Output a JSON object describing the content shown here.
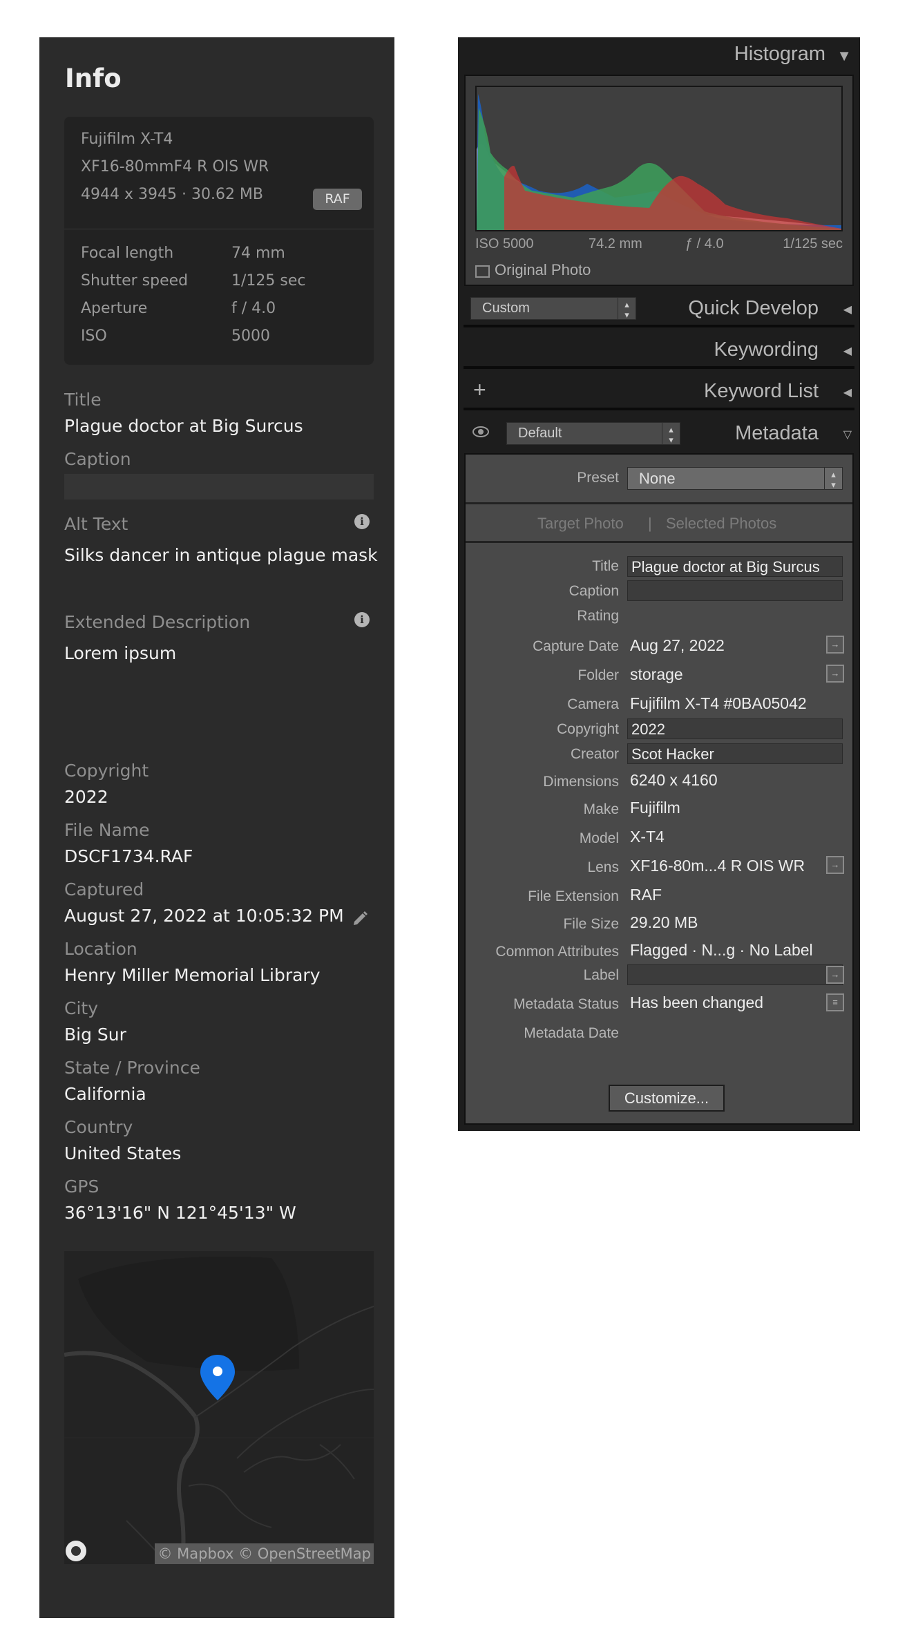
{
  "info_panel": {
    "title": "Info",
    "camera": {
      "model": "Fujifilm X-T4",
      "lens": "XF16-80mmF4 R OIS WR",
      "dimensions_size": "4944 x 3945  ·  30.62 MB",
      "format_badge": "RAF"
    },
    "exif": [
      {
        "label": "Focal length",
        "value": "74 mm"
      },
      {
        "label": "Shutter speed",
        "value": "1/125 sec"
      },
      {
        "label": "Aperture",
        "value": "f / 4.0"
      },
      {
        "label": "ISO",
        "value": "5000"
      }
    ],
    "fields": {
      "title_label": "Title",
      "title_value": "Plague doctor at Big Surcus",
      "caption_label": "Caption",
      "alt_label": "Alt Text",
      "alt_value": "Silks dancer in antique plague mask",
      "ext_label": "Extended Description",
      "ext_value": "Lorem ipsum",
      "copyright_label": "Copyright",
      "copyright_value": "2022",
      "filename_label": "File Name",
      "filename_value": "DSCF1734.RAF",
      "captured_label": "Captured",
      "captured_value": "August 27, 2022 at 10:05:32 PM",
      "location_label": "Location",
      "location_value": "Henry Miller Memorial Library",
      "city_label": "City",
      "city_value": "Big Sur",
      "state_label": "State / Province",
      "state_value": "California",
      "country_label": "Country",
      "country_value": "United States",
      "gps_label": "GPS",
      "gps_value": "36°13'16\" N 121°45'13\" W"
    },
    "map": {
      "credit": "© Mapbox © OpenStreetMap",
      "pin_color": "#1473e6"
    }
  },
  "lightroom_panel": {
    "histogram": {
      "title": "Histogram",
      "iso": "ISO 5000",
      "focal": "74.2 mm",
      "aperture": "ƒ / 4.0",
      "shutter": "1/125 sec",
      "original_photo_label": "Original Photo",
      "original_photo_checked": false
    },
    "quick_develop": {
      "title": "Quick Develop",
      "preset": "Custom"
    },
    "keywording": {
      "title": "Keywording"
    },
    "keyword_list": {
      "title": "Keyword List",
      "add_icon": "plus-icon"
    },
    "metadata": {
      "title": "Metadata",
      "view_preset": "Default",
      "preset_label": "Preset",
      "preset_value": "None",
      "target_photo": "Target Photo",
      "selected_photos": "Selected Photos",
      "rows": {
        "title_label": "Title",
        "title_value": "Plague doctor at Big Surcus",
        "caption_label": "Caption",
        "caption_value": "",
        "rating_label": "Rating",
        "capture_date_label": "Capture Date",
        "capture_date_value": "Aug 27, 2022",
        "folder_label": "Folder",
        "folder_value": "storage",
        "camera_label": "Camera",
        "camera_value": "Fujifilm X-T4 #0BA05042",
        "copyright_label": "Copyright",
        "copyright_value": "2022",
        "creator_label": "Creator",
        "creator_value": "Scot Hacker",
        "dimensions_label": "Dimensions",
        "dimensions_value": "6240 x 4160",
        "make_label": "Make",
        "make_value": "Fujifilm",
        "model_label": "Model",
        "model_value": "X-T4",
        "lens_label": "Lens",
        "lens_value": "XF16-80m...4 R OIS WR",
        "ext_label": "File Extension",
        "ext_value": "RAF",
        "size_label": "File Size",
        "size_value": "29.20 MB",
        "common_label": "Common Attributes",
        "common_value": "Flagged  ·  N...g  ·  No Label",
        "label_label": "Label",
        "label_value": "",
        "status_label": "Metadata Status",
        "status_value": "Has been changed",
        "meta_date_label": "Metadata Date"
      },
      "customize_button": "Customize..."
    }
  }
}
